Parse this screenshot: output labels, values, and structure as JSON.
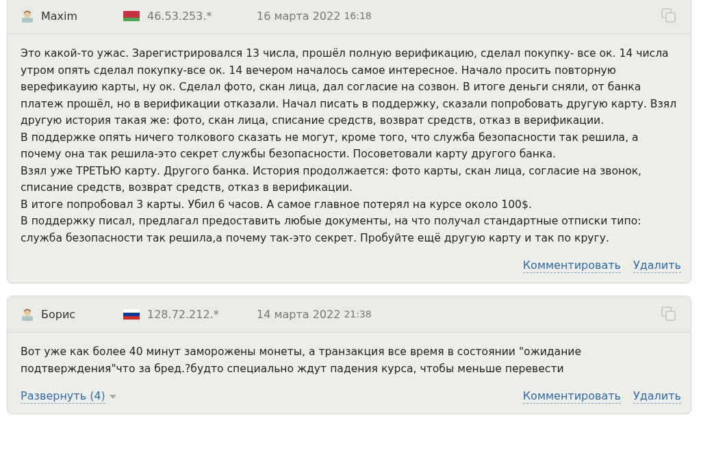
{
  "comments": [
    {
      "author": "Maxim",
      "flag": {
        "kind": "belarus"
      },
      "ip": "46.53.253.*",
      "date": "16 марта 2022",
      "time": "16:18",
      "paragraphs": [
        "Это какой-то ужас. Зарегистрировался 13 числа, прошёл полную верификацию, сделал покупку- все ок. 14 числа утром опять сделал покупку-все ок. 14 вечером началось самое интересное. Начало просить повторную верефикауию карты, ну ок. Сделал фото, скан лица, дал согласие на созвон. В итоге деньги сняли, от банка платеж прошёл, но в верификации отказали. Начал писать в поддержку, сказали попробовать другую карту. Взял другую история такая же: фото, скан лица, списание средств, возврат средств, отказ в верификации.",
        "В поддержке опять ничего толкового сказать не могут, кроме того, что служба безопасности так решила, а почему она так решила-это секрет службы безопасности. Посоветовали карту другого банка.",
        "Взял уже ТРЕТЬЮ карту. Другого банка. История продолжается: фото карты, скан лица, согласие на звонок, списание средств, возврат средств, отказ в верификации.",
        "В итоге попробовал 3 карты. Убил 6 часов. А самое главное потерял на курсе около 100$.",
        "В поддержку писал, предлагал предоставить любые документы, на что получал стандартные отписки типо: служба безопасности так решила,а почему так-это секрет. Пробуйте ещё другую карту и так по кругу."
      ],
      "actions": [
        "Комментировать",
        "Удалить"
      ]
    },
    {
      "author": "Борис",
      "flag": {
        "kind": "russia"
      },
      "ip": "128.72.212.*",
      "date": "14 марта 2022",
      "time": "21:38",
      "paragraphs": [
        "Вот уже как более 40 минут заморожены монеты, а транзакция все время в состоянии \"ожидание подтверждения\"что за бред.?будто специально ждут падения курса, чтобы меньше перевести"
      ],
      "expand": "Развернуть (4)",
      "actions": [
        "Комментировать",
        "Удалить"
      ]
    }
  ]
}
